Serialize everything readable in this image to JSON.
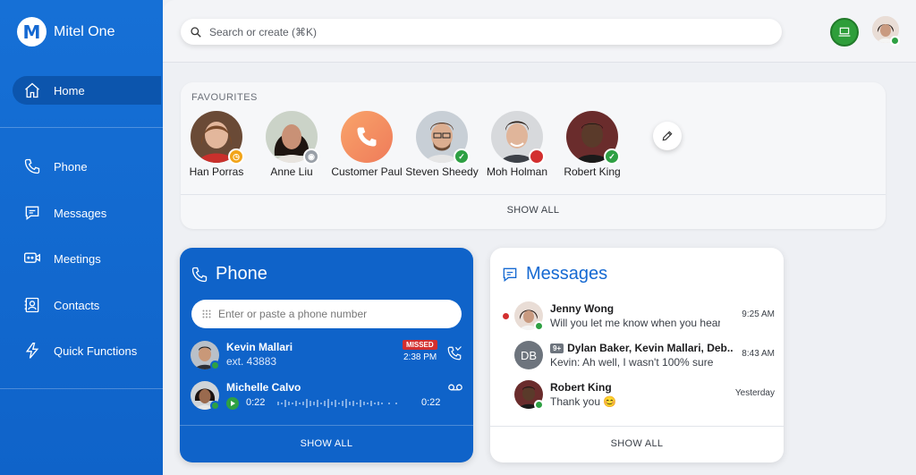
{
  "app": {
    "name": "Mitel One",
    "logo_letter": "M"
  },
  "colors": {
    "brand": "#1569d2",
    "sidebar": "#1670d6",
    "online": "#2ea043",
    "busy": "#d32f2f",
    "away": "#f2a51a",
    "missed": "#d32f2f"
  },
  "sidebar": {
    "items": [
      {
        "label": "Home",
        "icon": "home-icon",
        "active": true
      },
      {
        "label": "Phone",
        "icon": "phone-icon"
      },
      {
        "label": "Messages",
        "icon": "message-icon"
      },
      {
        "label": "Meetings",
        "icon": "meeting-icon"
      },
      {
        "label": "Contacts",
        "icon": "contacts-icon"
      },
      {
        "label": "Quick Functions",
        "icon": "lightning-icon"
      }
    ]
  },
  "search": {
    "placeholder": "Search or create (⌘K)"
  },
  "favourites": {
    "title": "FAVOURITES",
    "people": [
      {
        "name": "Han Porras",
        "status": "away"
      },
      {
        "name": "Anne Liu",
        "status": "offline"
      },
      {
        "name": "Customer Paul",
        "status": "none"
      },
      {
        "name": "Steven Sheedy",
        "status": "online"
      },
      {
        "name": "Moh Holman",
        "status": "busy"
      },
      {
        "name": "Robert King",
        "status": "online"
      }
    ],
    "show_all": "SHOW ALL"
  },
  "phone": {
    "title": "Phone",
    "input_placeholder": "Enter or paste a phone number",
    "calls": [
      {
        "name": "Kevin Mallari",
        "detail": "ext. 43883",
        "badge": "MISSED",
        "time": "2:38 PM"
      },
      {
        "name": "Michelle Calvo",
        "voicemail_start": "0:22",
        "voicemail_end": "0:22"
      }
    ],
    "show_all": "SHOW ALL"
  },
  "messages": {
    "title": "Messages",
    "items": [
      {
        "name": "Jenny Wong",
        "preview": "Will you let me know when you hear…",
        "time": "9:25 AM",
        "unread": true
      },
      {
        "name": "Dylan Baker, Kevin Mallari, Deb..",
        "initials": "DB",
        "count": "9+",
        "preview": "Kevin: Ah well, I wasn't 100% sure",
        "time": "8:43 AM"
      },
      {
        "name": "Robert King",
        "preview": "Thank you 😊",
        "time": "Yesterday"
      }
    ],
    "show_all": "SHOW ALL"
  }
}
